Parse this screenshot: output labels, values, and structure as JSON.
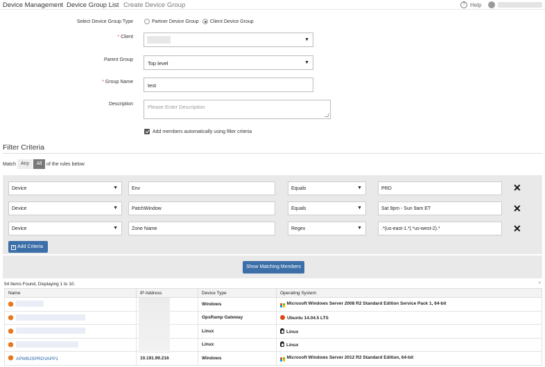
{
  "breadcrumb": {
    "items": [
      "Device Management",
      "Device Group List",
      "Create Device Group"
    ],
    "separator": "›"
  },
  "header": {
    "help_label": "Help",
    "help_icon": "question-circle-icon",
    "user_icon": "user-avatar-icon"
  },
  "form": {
    "group_type": {
      "label": "Select Device Group Type",
      "options": [
        "Partner Device Group",
        "Client Device Group"
      ],
      "selected": "Client Device Group"
    },
    "client": {
      "label": "Client",
      "required_mark": "*",
      "value": ""
    },
    "parent_group": {
      "label": "Parent Group",
      "value": "Top level"
    },
    "group_name": {
      "label": "Group Name",
      "required_mark": "*",
      "value": "test"
    },
    "description": {
      "label": "Description",
      "placeholder": "Please Enter Description",
      "value": ""
    },
    "auto_add": {
      "label": "Add members automatically using filter criteria",
      "checked": true
    }
  },
  "filter": {
    "title": "Filter Criteria",
    "match_label": "Match",
    "match_options": [
      "Any",
      "All"
    ],
    "match_selected": "All",
    "rules_suffix": "of the rules below",
    "rules": [
      {
        "entity": "Device",
        "attribute": "Env",
        "operator": "Equals",
        "value": "PRD"
      },
      {
        "entity": "Device",
        "attribute": "PatchWindow",
        "operator": "Equals",
        "value": "Sat 9pm - Sun 9am ET"
      },
      {
        "entity": "Device",
        "attribute": "Zone Name",
        "operator": "Regex",
        "value": ".*(us-east-1.*|.*us-west-2).*"
      }
    ],
    "remove_icon": "close-x-icon",
    "add_criteria_label": "Add Criteria",
    "show_matching_label": "Show Matching Members"
  },
  "results": {
    "summary": "54 Items Found, Displaying 1 to 10.",
    "close_symbol": "×",
    "columns": [
      "Name",
      "IP Address",
      "Device Type",
      "Operating System"
    ],
    "rows": [
      {
        "name": "",
        "ip": "",
        "device_type": "Windows",
        "os": "Microsoft Windows Server 2008 R2 Standard Edition Service Pack 1, 64-bit",
        "os_icon": "windows-icon"
      },
      {
        "name": "",
        "ip": "",
        "device_type": "OpsRamp Gateway",
        "os": "Ubuntu 14.04.5 LTS",
        "os_icon": "ubuntu-icon"
      },
      {
        "name": "",
        "ip": "",
        "device_type": "Linux",
        "os": "Linux",
        "os_icon": "linux-icon"
      },
      {
        "name": "",
        "ip": "",
        "device_type": "Linux",
        "os": "Linux",
        "os_icon": "linux-icon"
      },
      {
        "name": "APWBJSPRDVAPP1",
        "ip": "10.191.99.216",
        "device_type": "Windows",
        "os": "Microsoft Windows Server 2012 R2 Standard Edition, 64-bit",
        "os_icon": "windows-icon"
      }
    ]
  },
  "colors": {
    "primary_button": "#3c6fa8",
    "criteria_bg": "#e9e9e9",
    "required": "#d9534f",
    "link": "#2a64a8",
    "aws_orange": "#e8771e"
  }
}
